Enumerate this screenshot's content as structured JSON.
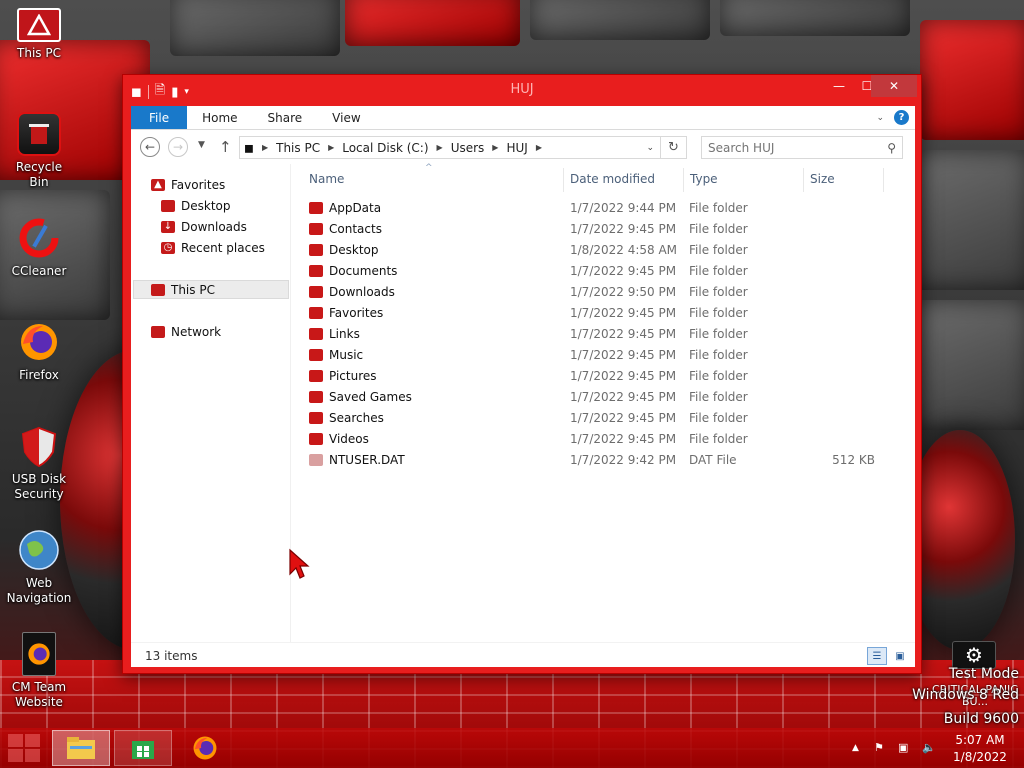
{
  "desktop": {
    "icons": [
      {
        "label": "This PC",
        "icon": "monitor-warning-icon"
      },
      {
        "label": "Recycle Bin",
        "icon": "recycle-bin-icon"
      },
      {
        "label": "CCleaner",
        "icon": "ccleaner-icon"
      },
      {
        "label": "Firefox",
        "icon": "firefox-icon"
      },
      {
        "label": "USB Disk Security",
        "icon": "shield-icon"
      },
      {
        "label": "Web Navigation",
        "icon": "globe-icon"
      },
      {
        "label": "CM Team Website",
        "icon": "firefox-icon"
      }
    ],
    "watermark": {
      "line1": "Test Mode",
      "line2": "Windows 8 Red",
      "line3": "Build 9600"
    },
    "gadget_label": "CRITICAL PANIC BU...",
    "accent_color": "#e81e1e"
  },
  "window": {
    "title": "HUJ",
    "controls": {
      "minimize": "—",
      "maximize": "☐",
      "close": "✕"
    }
  },
  "ribbon": {
    "tabs": [
      "File",
      "Home",
      "Share",
      "View"
    ]
  },
  "navigation": {
    "path": [
      "This PC",
      "Local Disk (C:)",
      "Users",
      "HUJ"
    ],
    "search_placeholder": "Search HUJ"
  },
  "nav_pane": {
    "favorites_label": "Favorites",
    "favorites": [
      "Desktop",
      "Downloads",
      "Recent places"
    ],
    "this_pc_label": "This PC",
    "network_label": "Network"
  },
  "file_list": {
    "columns": [
      "Name",
      "Date modified",
      "Type",
      "Size"
    ],
    "rows": [
      {
        "name": "AppData",
        "date": "1/7/2022 9:44 PM",
        "type": "File folder",
        "size": ""
      },
      {
        "name": "Contacts",
        "date": "1/7/2022 9:45 PM",
        "type": "File folder",
        "size": ""
      },
      {
        "name": "Desktop",
        "date": "1/8/2022 4:58 AM",
        "type": "File folder",
        "size": ""
      },
      {
        "name": "Documents",
        "date": "1/7/2022 9:45 PM",
        "type": "File folder",
        "size": ""
      },
      {
        "name": "Downloads",
        "date": "1/7/2022 9:50 PM",
        "type": "File folder",
        "size": ""
      },
      {
        "name": "Favorites",
        "date": "1/7/2022 9:45 PM",
        "type": "File folder",
        "size": ""
      },
      {
        "name": "Links",
        "date": "1/7/2022 9:45 PM",
        "type": "File folder",
        "size": ""
      },
      {
        "name": "Music",
        "date": "1/7/2022 9:45 PM",
        "type": "File folder",
        "size": ""
      },
      {
        "name": "Pictures",
        "date": "1/7/2022 9:45 PM",
        "type": "File folder",
        "size": ""
      },
      {
        "name": "Saved Games",
        "date": "1/7/2022 9:45 PM",
        "type": "File folder",
        "size": ""
      },
      {
        "name": "Searches",
        "date": "1/7/2022 9:45 PM",
        "type": "File folder",
        "size": ""
      },
      {
        "name": "Videos",
        "date": "1/7/2022 9:45 PM",
        "type": "File folder",
        "size": ""
      },
      {
        "name": "NTUSER.DAT",
        "date": "1/7/2022 9:42 PM",
        "type": "DAT File",
        "size": "512 KB"
      }
    ]
  },
  "status": {
    "item_count": "13 items"
  },
  "taskbar": {
    "apps": [
      "file-explorer-icon",
      "store-icon",
      "firefox-icon"
    ],
    "clock_time": "5:07 AM",
    "clock_date": "1/8/2022"
  }
}
